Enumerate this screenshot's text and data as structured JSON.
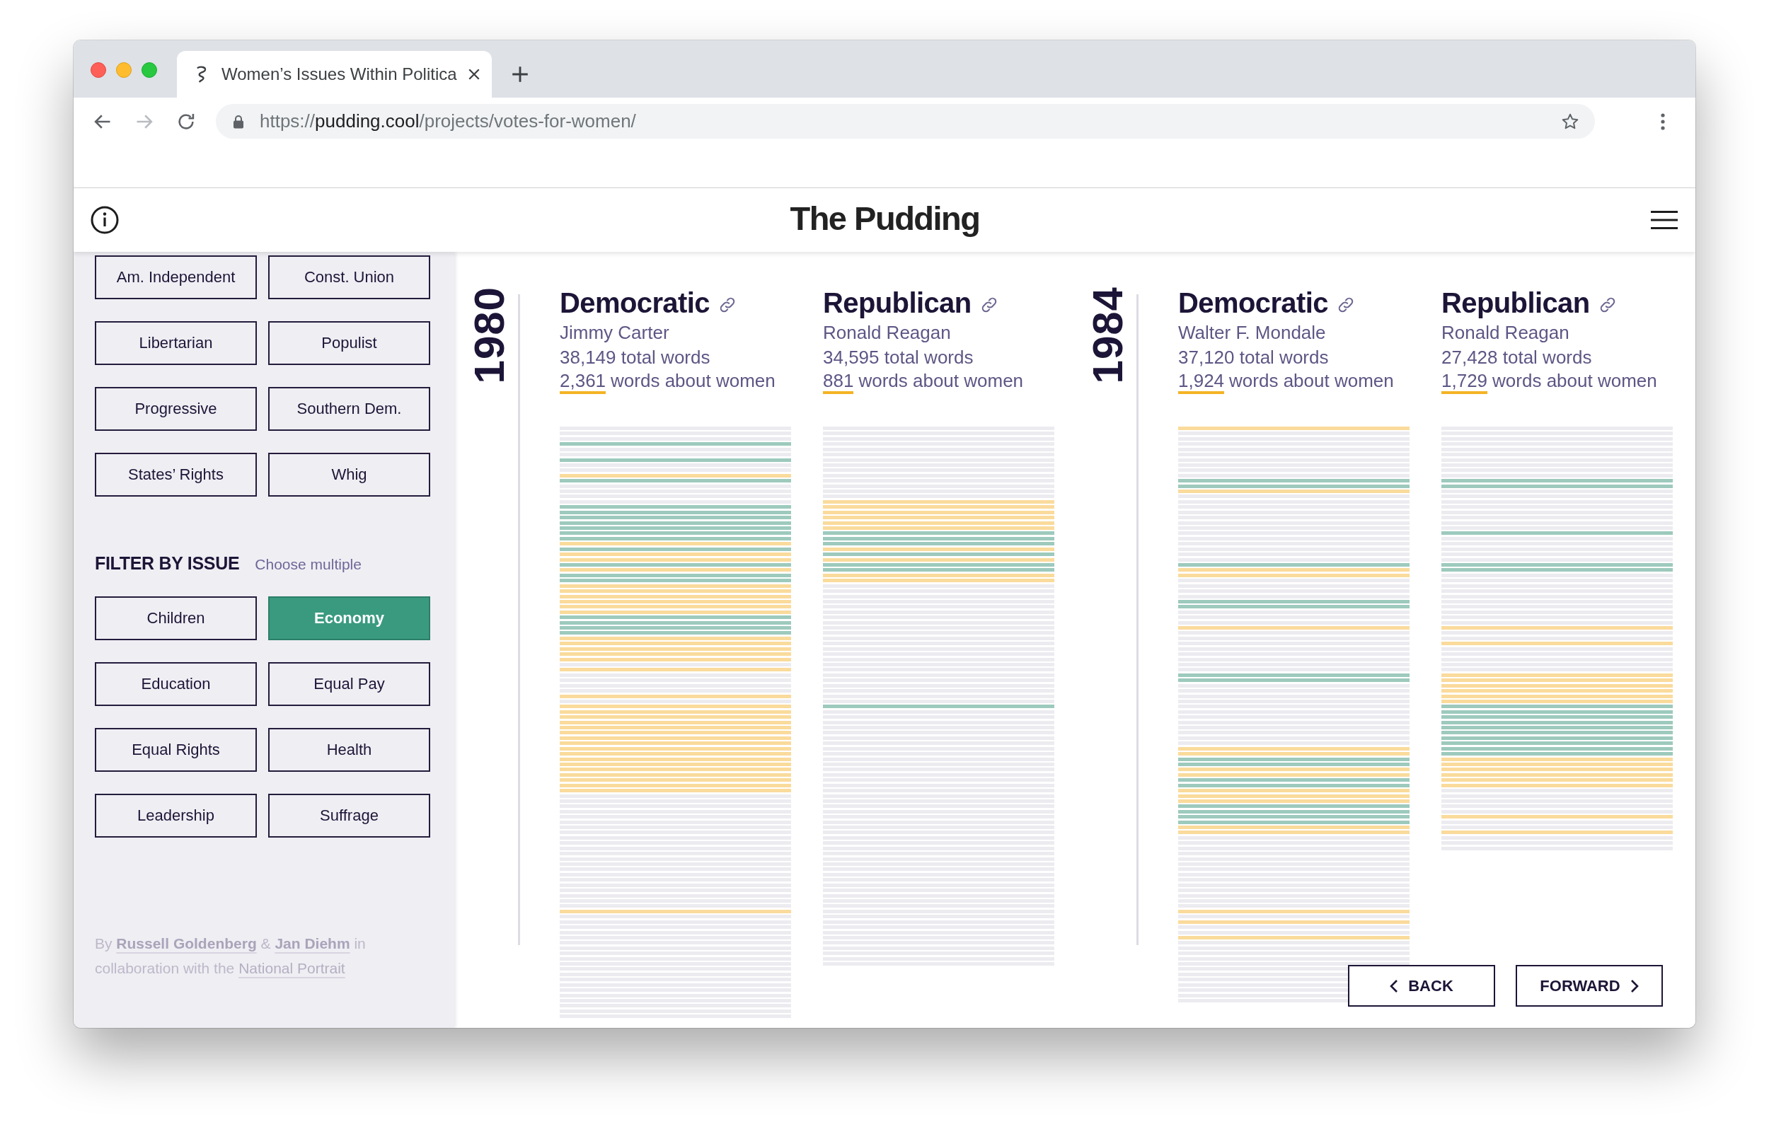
{
  "browser": {
    "tabs": [
      {
        "title": "Women’s Issues Within Politica",
        "selected": true
      }
    ],
    "back": {
      "disabled": false
    },
    "forward": {
      "disabled": true
    },
    "url": {
      "scheme": "https://",
      "host": "pudding.cool",
      "path": "/projects/votes-for-women/"
    }
  },
  "header": {
    "logo": "The Pudding"
  },
  "sidebar": {
    "party_filters": [
      {
        "label": "Am. Independent",
        "selected": false
      },
      {
        "label": "Const. Union",
        "selected": false
      },
      {
        "label": "Libertarian",
        "selected": false
      },
      {
        "label": "Populist",
        "selected": false
      },
      {
        "label": "Progressive",
        "selected": false
      },
      {
        "label": "Southern Dem.",
        "selected": false
      },
      {
        "label": "States’ Rights",
        "selected": false
      },
      {
        "label": "Whig",
        "selected": false
      }
    ],
    "issue_filter": {
      "title": "FILTER BY ISSUE",
      "hint": "Choose multiple",
      "options": [
        {
          "label": "Children",
          "selected": false
        },
        {
          "label": "Economy",
          "selected": true
        },
        {
          "label": "Education",
          "selected": false
        },
        {
          "label": "Equal Pay",
          "selected": false
        },
        {
          "label": "Equal Rights",
          "selected": false
        },
        {
          "label": "Health",
          "selected": false
        },
        {
          "label": "Leadership",
          "selected": false
        },
        {
          "label": "Suffrage",
          "selected": false
        }
      ]
    },
    "credits": [
      {
        "kind": "text",
        "text": "By "
      },
      {
        "kind": "author",
        "text": "Russell Goldenberg"
      },
      {
        "kind": "text",
        "text": " & "
      },
      {
        "kind": "author",
        "text": "Jan Diehm"
      },
      {
        "kind": "text",
        "text": " in collaboration with the "
      },
      {
        "kind": "link",
        "text": "National Portrait"
      }
    ]
  },
  "years": [
    {
      "year": "1980",
      "speeches": [
        {
          "party": "Democratic",
          "candidate": "Jimmy Carter",
          "total_words": "38,149 total words",
          "women_count": "2,361",
          "women_label": "words about women",
          "lines": [
            {
              "kind": "plain"
            },
            {
              "kind": "plain"
            },
            {
              "kind": "plain"
            },
            {
              "kind": "issue"
            },
            {
              "kind": "plain"
            },
            {
              "kind": "plain"
            },
            {
              "kind": "issue"
            },
            {
              "kind": "plain"
            },
            {
              "kind": "plain"
            },
            {
              "kind": "women"
            },
            {
              "kind": "issue"
            },
            {
              "kind": "plain"
            },
            {
              "kind": "plain"
            },
            {
              "kind": "plain"
            },
            {
              "kind": "plain"
            },
            {
              "kind": "issue"
            },
            {
              "kind": "issue"
            },
            {
              "kind": "issue"
            },
            {
              "kind": "issue"
            },
            {
              "kind": "issue"
            },
            {
              "kind": "issue"
            },
            {
              "kind": "issue"
            },
            {
              "kind": "women"
            },
            {
              "kind": "issue"
            },
            {
              "kind": "women"
            },
            {
              "kind": "women"
            },
            {
              "kind": "issue"
            },
            {
              "kind": "women"
            },
            {
              "kind": "issue"
            },
            {
              "kind": "issue"
            },
            {
              "kind": "women"
            },
            {
              "kind": "women"
            },
            {
              "kind": "women"
            },
            {
              "kind": "women"
            },
            {
              "kind": "women"
            },
            {
              "kind": "women"
            },
            {
              "kind": "issue"
            },
            {
              "kind": "issue"
            },
            {
              "kind": "issue"
            },
            {
              "kind": "issue"
            },
            {
              "kind": "women"
            },
            {
              "kind": "women"
            },
            {
              "kind": "women"
            },
            {
              "kind": "women"
            },
            {
              "kind": "women"
            },
            {
              "kind": "plain"
            },
            {
              "kind": "women"
            },
            {
              "kind": "plain"
            },
            {
              "kind": "plain"
            },
            {
              "kind": "plain"
            },
            {
              "kind": "plain"
            },
            {
              "kind": "women"
            },
            {
              "kind": "plain"
            },
            {
              "kind": "women"
            },
            {
              "kind": "women"
            },
            {
              "kind": "women"
            },
            {
              "kind": "women"
            },
            {
              "kind": "women"
            },
            {
              "kind": "women"
            },
            {
              "kind": "women"
            },
            {
              "kind": "women"
            },
            {
              "kind": "women"
            },
            {
              "kind": "women"
            },
            {
              "kind": "women"
            },
            {
              "kind": "women"
            },
            {
              "kind": "women"
            },
            {
              "kind": "women"
            },
            {
              "kind": "women"
            },
            {
              "kind": "women"
            },
            {
              "kind": "women"
            },
            {
              "kind": "plain"
            },
            {
              "kind": "plain"
            },
            {
              "kind": "plain"
            },
            {
              "kind": "plain"
            },
            {
              "kind": "plain"
            },
            {
              "kind": "plain"
            },
            {
              "kind": "plain"
            },
            {
              "kind": "plain"
            },
            {
              "kind": "plain"
            },
            {
              "kind": "plain"
            },
            {
              "kind": "plain"
            },
            {
              "kind": "plain"
            },
            {
              "kind": "plain"
            },
            {
              "kind": "plain"
            },
            {
              "kind": "plain"
            },
            {
              "kind": "plain"
            },
            {
              "kind": "plain"
            },
            {
              "kind": "plain"
            },
            {
              "kind": "plain"
            },
            {
              "kind": "plain"
            },
            {
              "kind": "plain"
            },
            {
              "kind": "plain"
            },
            {
              "kind": "women"
            },
            {
              "kind": "plain"
            },
            {
              "kind": "plain"
            },
            {
              "kind": "plain"
            },
            {
              "kind": "plain"
            },
            {
              "kind": "plain"
            },
            {
              "kind": "plain"
            },
            {
              "kind": "plain"
            },
            {
              "kind": "plain"
            },
            {
              "kind": "plain"
            },
            {
              "kind": "plain"
            },
            {
              "kind": "plain"
            },
            {
              "kind": "plain"
            },
            {
              "kind": "plain"
            },
            {
              "kind": "plain"
            },
            {
              "kind": "plain"
            },
            {
              "kind": "plain"
            },
            {
              "kind": "plain"
            },
            {
              "kind": "plain"
            },
            {
              "kind": "plain"
            },
            {
              "kind": "plain"
            }
          ]
        },
        {
          "party": "Republican",
          "candidate": "Ronald Reagan",
          "total_words": "34,595 total words",
          "women_count": "881",
          "women_label": "words about women",
          "lines": [
            {
              "kind": "plain"
            },
            {
              "kind": "plain"
            },
            {
              "kind": "plain"
            },
            {
              "kind": "plain"
            },
            {
              "kind": "plain"
            },
            {
              "kind": "plain"
            },
            {
              "kind": "plain"
            },
            {
              "kind": "plain"
            },
            {
              "kind": "plain"
            },
            {
              "kind": "plain"
            },
            {
              "kind": "plain"
            },
            {
              "kind": "plain"
            },
            {
              "kind": "plain"
            },
            {
              "kind": "plain"
            },
            {
              "kind": "women"
            },
            {
              "kind": "women"
            },
            {
              "kind": "women"
            },
            {
              "kind": "women"
            },
            {
              "kind": "women"
            },
            {
              "kind": "women"
            },
            {
              "kind": "issue"
            },
            {
              "kind": "issue"
            },
            {
              "kind": "issue"
            },
            {
              "kind": "women"
            },
            {
              "kind": "issue"
            },
            {
              "kind": "women"
            },
            {
              "kind": "issue"
            },
            {
              "kind": "issue"
            },
            {
              "kind": "women"
            },
            {
              "kind": "women"
            },
            {
              "kind": "plain"
            },
            {
              "kind": "plain"
            },
            {
              "kind": "plain"
            },
            {
              "kind": "plain"
            },
            {
              "kind": "plain"
            },
            {
              "kind": "plain"
            },
            {
              "kind": "plain"
            },
            {
              "kind": "plain"
            },
            {
              "kind": "plain"
            },
            {
              "kind": "plain"
            },
            {
              "kind": "plain"
            },
            {
              "kind": "plain"
            },
            {
              "kind": "plain"
            },
            {
              "kind": "plain"
            },
            {
              "kind": "plain"
            },
            {
              "kind": "plain"
            },
            {
              "kind": "plain"
            },
            {
              "kind": "plain"
            },
            {
              "kind": "plain"
            },
            {
              "kind": "plain"
            },
            {
              "kind": "plain"
            },
            {
              "kind": "plain"
            },
            {
              "kind": "plain"
            },
            {
              "kind": "issue"
            },
            {
              "kind": "plain"
            },
            {
              "kind": "plain"
            },
            {
              "kind": "plain"
            },
            {
              "kind": "plain"
            },
            {
              "kind": "plain"
            },
            {
              "kind": "plain"
            },
            {
              "kind": "plain"
            },
            {
              "kind": "plain"
            },
            {
              "kind": "plain"
            },
            {
              "kind": "plain"
            },
            {
              "kind": "plain"
            },
            {
              "kind": "plain"
            },
            {
              "kind": "plain"
            },
            {
              "kind": "plain"
            },
            {
              "kind": "plain"
            },
            {
              "kind": "plain"
            },
            {
              "kind": "plain"
            },
            {
              "kind": "plain"
            },
            {
              "kind": "plain"
            },
            {
              "kind": "plain"
            },
            {
              "kind": "plain"
            },
            {
              "kind": "plain"
            },
            {
              "kind": "plain"
            },
            {
              "kind": "plain"
            },
            {
              "kind": "plain"
            },
            {
              "kind": "plain"
            },
            {
              "kind": "plain"
            },
            {
              "kind": "plain"
            },
            {
              "kind": "plain"
            },
            {
              "kind": "plain"
            },
            {
              "kind": "plain"
            },
            {
              "kind": "plain"
            },
            {
              "kind": "plain"
            },
            {
              "kind": "plain"
            },
            {
              "kind": "plain"
            },
            {
              "kind": "plain"
            },
            {
              "kind": "plain"
            },
            {
              "kind": "plain"
            },
            {
              "kind": "plain"
            },
            {
              "kind": "plain"
            },
            {
              "kind": "plain"
            },
            {
              "kind": "plain"
            },
            {
              "kind": "plain"
            },
            {
              "kind": "plain"
            },
            {
              "kind": "plain"
            },
            {
              "kind": "plain"
            },
            {
              "kind": "plain"
            },
            {
              "kind": "plain"
            },
            {
              "kind": "plain"
            }
          ]
        }
      ]
    },
    {
      "year": "1984",
      "speeches": [
        {
          "party": "Democratic",
          "candidate": "Walter F. Mondale",
          "total_words": "37,120 total words",
          "women_count": "1,924",
          "women_label": "words about women",
          "lines": [
            {
              "kind": "women"
            },
            {
              "kind": "plain"
            },
            {
              "kind": "plain"
            },
            {
              "kind": "plain"
            },
            {
              "kind": "plain"
            },
            {
              "kind": "plain"
            },
            {
              "kind": "plain"
            },
            {
              "kind": "plain"
            },
            {
              "kind": "plain"
            },
            {
              "kind": "plain"
            },
            {
              "kind": "issue"
            },
            {
              "kind": "issue"
            },
            {
              "kind": "women"
            },
            {
              "kind": "plain"
            },
            {
              "kind": "plain"
            },
            {
              "kind": "plain"
            },
            {
              "kind": "plain"
            },
            {
              "kind": "plain"
            },
            {
              "kind": "plain"
            },
            {
              "kind": "plain"
            },
            {
              "kind": "plain"
            },
            {
              "kind": "plain"
            },
            {
              "kind": "plain"
            },
            {
              "kind": "plain"
            },
            {
              "kind": "plain"
            },
            {
              "kind": "plain"
            },
            {
              "kind": "issue"
            },
            {
              "kind": "women"
            },
            {
              "kind": "women"
            },
            {
              "kind": "plain"
            },
            {
              "kind": "plain"
            },
            {
              "kind": "plain"
            },
            {
              "kind": "plain"
            },
            {
              "kind": "issue"
            },
            {
              "kind": "issue"
            },
            {
              "kind": "plain"
            },
            {
              "kind": "plain"
            },
            {
              "kind": "plain"
            },
            {
              "kind": "women"
            },
            {
              "kind": "plain"
            },
            {
              "kind": "plain"
            },
            {
              "kind": "plain"
            },
            {
              "kind": "plain"
            },
            {
              "kind": "plain"
            },
            {
              "kind": "plain"
            },
            {
              "kind": "plain"
            },
            {
              "kind": "plain"
            },
            {
              "kind": "issue"
            },
            {
              "kind": "issue"
            },
            {
              "kind": "plain"
            },
            {
              "kind": "plain"
            },
            {
              "kind": "plain"
            },
            {
              "kind": "plain"
            },
            {
              "kind": "plain"
            },
            {
              "kind": "plain"
            },
            {
              "kind": "plain"
            },
            {
              "kind": "plain"
            },
            {
              "kind": "plain"
            },
            {
              "kind": "plain"
            },
            {
              "kind": "plain"
            },
            {
              "kind": "plain"
            },
            {
              "kind": "women"
            },
            {
              "kind": "women"
            },
            {
              "kind": "issue"
            },
            {
              "kind": "issue"
            },
            {
              "kind": "women"
            },
            {
              "kind": "women"
            },
            {
              "kind": "issue"
            },
            {
              "kind": "issue"
            },
            {
              "kind": "women"
            },
            {
              "kind": "women"
            },
            {
              "kind": "women"
            },
            {
              "kind": "issue"
            },
            {
              "kind": "issue"
            },
            {
              "kind": "issue"
            },
            {
              "kind": "issue"
            },
            {
              "kind": "women"
            },
            {
              "kind": "women"
            },
            {
              "kind": "plain"
            },
            {
              "kind": "plain"
            },
            {
              "kind": "plain"
            },
            {
              "kind": "plain"
            },
            {
              "kind": "plain"
            },
            {
              "kind": "plain"
            },
            {
              "kind": "plain"
            },
            {
              "kind": "plain"
            },
            {
              "kind": "plain"
            },
            {
              "kind": "plain"
            },
            {
              "kind": "plain"
            },
            {
              "kind": "plain"
            },
            {
              "kind": "plain"
            },
            {
              "kind": "plain"
            },
            {
              "kind": "women"
            },
            {
              "kind": "plain"
            },
            {
              "kind": "women"
            },
            {
              "kind": "plain"
            },
            {
              "kind": "plain"
            },
            {
              "kind": "women"
            },
            {
              "kind": "plain"
            },
            {
              "kind": "plain"
            },
            {
              "kind": "plain"
            },
            {
              "kind": "plain"
            },
            {
              "kind": "plain"
            },
            {
              "kind": "plain"
            },
            {
              "kind": "plain"
            },
            {
              "kind": "plain"
            },
            {
              "kind": "plain"
            },
            {
              "kind": "plain"
            },
            {
              "kind": "plain"
            },
            {
              "kind": "plain"
            }
          ]
        },
        {
          "party": "Republican",
          "candidate": "Ronald Reagan",
          "total_words": "27,428 total words",
          "women_count": "1,729",
          "women_label": "words about women",
          "lines": [
            {
              "kind": "plain"
            },
            {
              "kind": "plain"
            },
            {
              "kind": "plain"
            },
            {
              "kind": "plain"
            },
            {
              "kind": "plain"
            },
            {
              "kind": "plain"
            },
            {
              "kind": "plain"
            },
            {
              "kind": "plain"
            },
            {
              "kind": "plain"
            },
            {
              "kind": "plain"
            },
            {
              "kind": "issue"
            },
            {
              "kind": "issue"
            },
            {
              "kind": "plain"
            },
            {
              "kind": "plain"
            },
            {
              "kind": "plain"
            },
            {
              "kind": "plain"
            },
            {
              "kind": "plain"
            },
            {
              "kind": "plain"
            },
            {
              "kind": "plain"
            },
            {
              "kind": "plain"
            },
            {
              "kind": "issue"
            },
            {
              "kind": "plain"
            },
            {
              "kind": "plain"
            },
            {
              "kind": "plain"
            },
            {
              "kind": "plain"
            },
            {
              "kind": "plain"
            },
            {
              "kind": "issue"
            },
            {
              "kind": "issue"
            },
            {
              "kind": "plain"
            },
            {
              "kind": "plain"
            },
            {
              "kind": "plain"
            },
            {
              "kind": "plain"
            },
            {
              "kind": "plain"
            },
            {
              "kind": "plain"
            },
            {
              "kind": "plain"
            },
            {
              "kind": "plain"
            },
            {
              "kind": "plain"
            },
            {
              "kind": "plain"
            },
            {
              "kind": "women"
            },
            {
              "kind": "plain"
            },
            {
              "kind": "plain"
            },
            {
              "kind": "women"
            },
            {
              "kind": "plain"
            },
            {
              "kind": "plain"
            },
            {
              "kind": "plain"
            },
            {
              "kind": "plain"
            },
            {
              "kind": "plain"
            },
            {
              "kind": "women"
            },
            {
              "kind": "women"
            },
            {
              "kind": "women"
            },
            {
              "kind": "women"
            },
            {
              "kind": "women"
            },
            {
              "kind": "women"
            },
            {
              "kind": "issue"
            },
            {
              "kind": "issue"
            },
            {
              "kind": "issue"
            },
            {
              "kind": "issue"
            },
            {
              "kind": "issue"
            },
            {
              "kind": "issue"
            },
            {
              "kind": "issue"
            },
            {
              "kind": "issue"
            },
            {
              "kind": "issue"
            },
            {
              "kind": "issue"
            },
            {
              "kind": "women"
            },
            {
              "kind": "women"
            },
            {
              "kind": "women"
            },
            {
              "kind": "women"
            },
            {
              "kind": "women"
            },
            {
              "kind": "women"
            },
            {
              "kind": "plain"
            },
            {
              "kind": "plain"
            },
            {
              "kind": "plain"
            },
            {
              "kind": "plain"
            },
            {
              "kind": "plain"
            },
            {
              "kind": "women"
            },
            {
              "kind": "plain"
            },
            {
              "kind": "plain"
            },
            {
              "kind": "women"
            },
            {
              "kind": "plain"
            },
            {
              "kind": "plain"
            },
            {
              "kind": "plain"
            }
          ]
        }
      ]
    }
  ],
  "navigation": {
    "back": "BACK",
    "forward": "FORWARD"
  }
}
